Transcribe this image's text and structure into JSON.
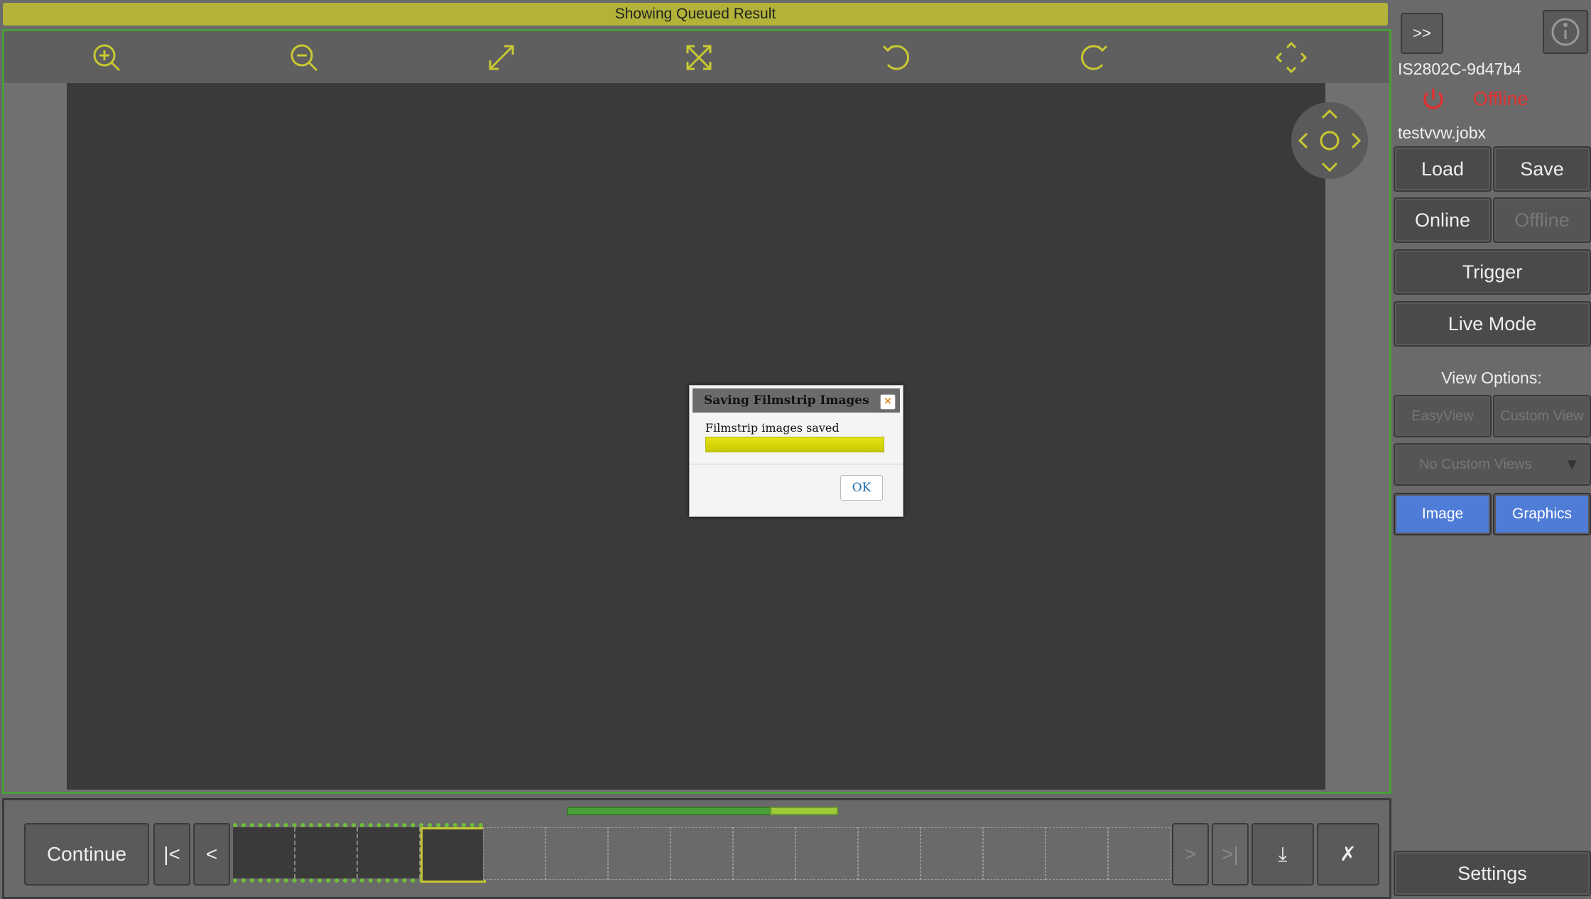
{
  "status_bar": {
    "text": "Showing Queued Result"
  },
  "toolbar": {
    "tools": [
      {
        "name": "zoom-in-icon"
      },
      {
        "name": "zoom-out-icon"
      },
      {
        "name": "fit-expand-icon"
      },
      {
        "name": "fit-window-icon"
      },
      {
        "name": "rotate-left-icon"
      },
      {
        "name": "rotate-right-icon"
      },
      {
        "name": "pan-arrows-icon"
      }
    ],
    "icon_color": "#c8c832"
  },
  "dialog": {
    "title": "Saving Filmstrip Images",
    "close_label": "×",
    "message": "Filmstrip images saved",
    "progress": 1.0,
    "ok_label": "OK"
  },
  "side_panel": {
    "expand_label": ">>",
    "device_name": "IS2802C-9d47b4",
    "device_status": "Offline",
    "device_status_color": "#e03030",
    "job_file": "testvvw.jobx",
    "load_label": "Load",
    "save_label": "Save",
    "online_label": "Online",
    "offline_label": "Offline",
    "trigger_label": "Trigger",
    "live_mode_label": "Live Mode",
    "view_options_label": "View Options:",
    "easyview_label": "EasyView",
    "custom_view_label": "Custom View",
    "custom_views_select": "No Custom Views",
    "image_label": "Image",
    "graphics_label": "Graphics",
    "settings_label": "Settings"
  },
  "filmstrip": {
    "continue_label": "Continue",
    "first_label": "|<",
    "prev_label": "<",
    "next_label": ">",
    "last_label": ">|",
    "download_label": "⤓",
    "close_label": "✗",
    "filled_frames": 4,
    "selected_frame": 4,
    "total_frames": 15
  }
}
